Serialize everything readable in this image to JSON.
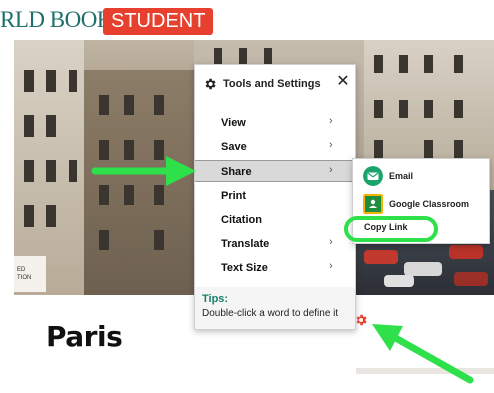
{
  "header": {
    "brand_text": "RLD BOOK",
    "badge_text": "STUDENT",
    "brand_color": "#1f6f6a",
    "badge_color": "#e8402f"
  },
  "article": {
    "title": "Paris",
    "partial_label_line1": "ED",
    "partial_label_line2": "TION"
  },
  "tools_menu": {
    "title": "Tools and Settings",
    "header_icon": "gear-icon",
    "close_glyph": "✕",
    "items": [
      {
        "label": "View",
        "has_submenu": true
      },
      {
        "label": "Save",
        "has_submenu": true
      },
      {
        "label": "Share",
        "has_submenu": true,
        "active": true
      },
      {
        "label": "Print",
        "has_submenu": false
      },
      {
        "label": "Citation",
        "has_submenu": false
      },
      {
        "label": "Translate",
        "has_submenu": true
      },
      {
        "label": "Text Size",
        "has_submenu": true
      }
    ],
    "chevron_glyph": "›",
    "tips_title": "Tips:",
    "tips_text": "Double-click a word to define it"
  },
  "share_menu": {
    "items": [
      {
        "label": "Email",
        "icon": "email-icon",
        "icon_color": "#1aa36b"
      },
      {
        "label": "Google Classroom",
        "icon": "google-classroom-icon",
        "icon_color": "#1e8e3e"
      },
      {
        "label": "Copy Link",
        "icon": null
      }
    ]
  },
  "annotations": {
    "arrow_color": "#2ee04a",
    "highlight_color": "#2ee04a"
  }
}
